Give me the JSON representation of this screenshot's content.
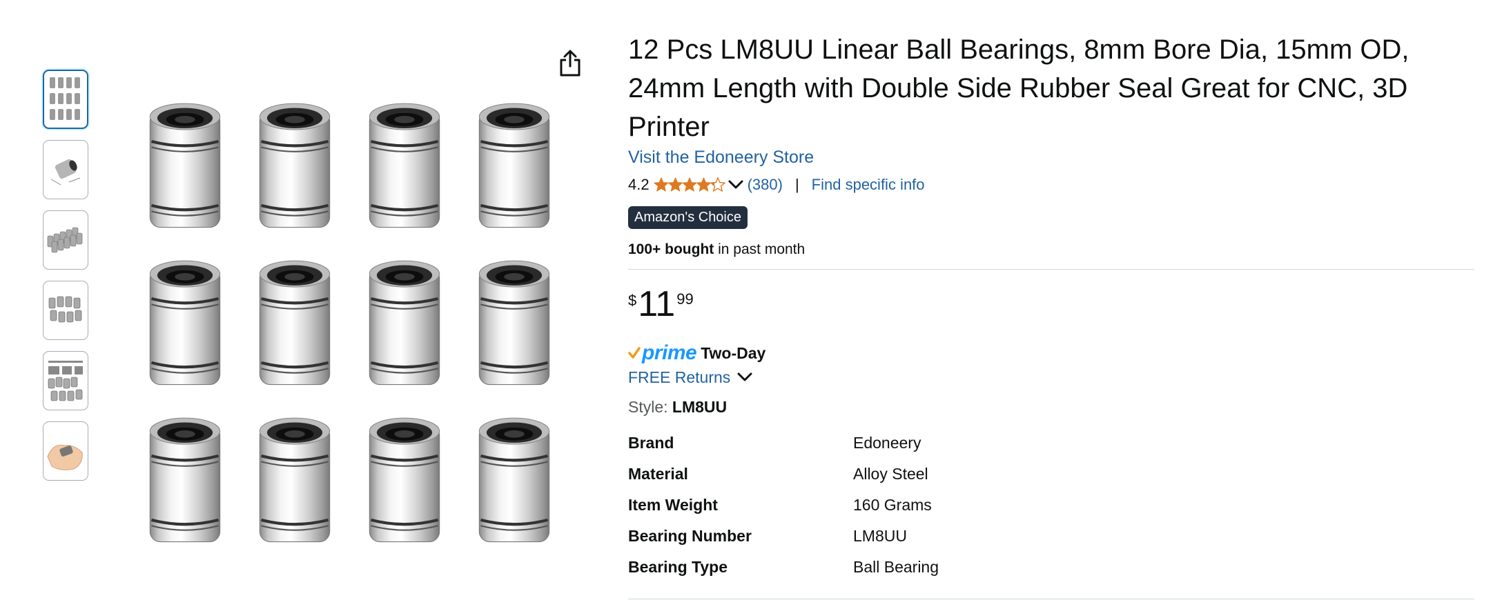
{
  "product": {
    "title": "12 Pcs LM8UU Linear Ball Bearings, 8mm Bore Dia, 15mm OD, 24mm Length with Double Side Rubber Seal Great for CNC, 3D Printer",
    "store_link": "Visit the Edoneery Store",
    "rating": "4.2",
    "stars": 4.2,
    "rating_count": "(380)",
    "separator": "|",
    "find_info": "Find specific info",
    "badge": "Amazon's Choice",
    "bought_bold": "100+ bought",
    "bought_rest": " in past month",
    "price": {
      "symbol": "$",
      "whole": "11",
      "fraction": "99"
    },
    "prime": {
      "word": "prime",
      "delivery": "Two-Day"
    },
    "returns": "FREE Returns",
    "style_label": "Style: ",
    "style_value": "LM8UU",
    "specs": [
      {
        "key": "Brand",
        "value": "Edoneery"
      },
      {
        "key": "Material",
        "value": "Alloy Steel"
      },
      {
        "key": "Item Weight",
        "value": "160 Grams"
      },
      {
        "key": "Bearing Number",
        "value": "LM8UU"
      },
      {
        "key": "Bearing Type",
        "value": "Ball Bearing"
      }
    ]
  },
  "colors": {
    "link": "#2162a1",
    "badge_bg": "#232f3e",
    "star": "#de7921",
    "prime_blue": "#1a98ff",
    "prime_check": "#f29b1b",
    "thumb_active": "#2162a1"
  },
  "icons": {
    "share": "share-icon",
    "rating_dropdown": "chevron-down-icon",
    "returns_dropdown": "chevron-down-icon"
  },
  "thumbnails": [
    {
      "name": "thumbnail-1",
      "active": true
    },
    {
      "name": "thumbnail-2",
      "active": false
    },
    {
      "name": "thumbnail-3",
      "active": false
    },
    {
      "name": "thumbnail-4",
      "active": false
    },
    {
      "name": "thumbnail-5",
      "active": false
    },
    {
      "name": "thumbnail-6",
      "active": false
    }
  ]
}
